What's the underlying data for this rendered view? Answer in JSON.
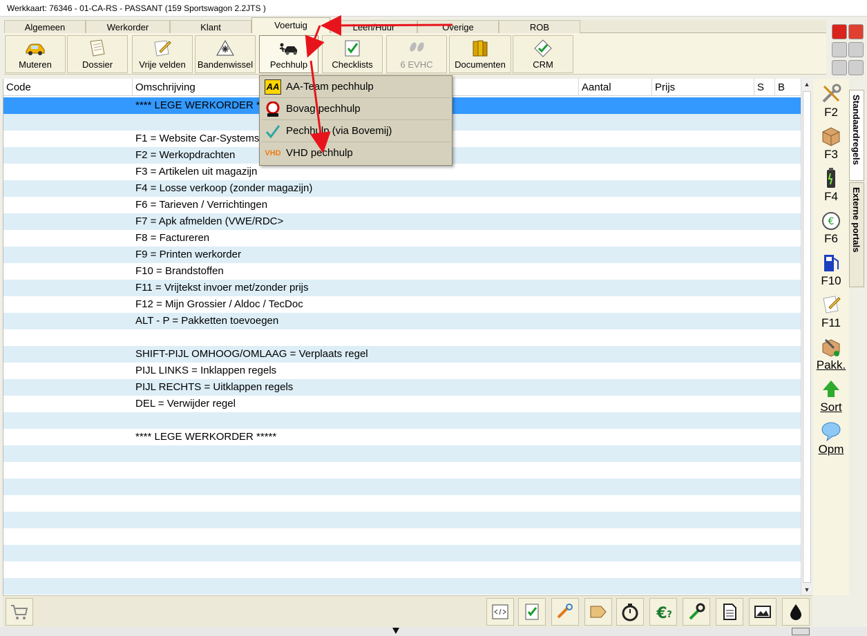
{
  "window": {
    "title": "Werkkaart: 76346 - 01-CA-RS - PASSANT  (159 Sportswagon  2.2JTS  )"
  },
  "tabs": [
    {
      "label": "Algemeen"
    },
    {
      "label": "Werkorder"
    },
    {
      "label": "Klant"
    },
    {
      "label": "Voertuig"
    },
    {
      "label": "Leen/Huur"
    },
    {
      "label": "Overige"
    },
    {
      "label": "ROB"
    }
  ],
  "toolbar": {
    "buttons": [
      {
        "label": "Muteren"
      },
      {
        "label": "Dossier"
      },
      {
        "label": "Vrije velden"
      },
      {
        "label": "Bandenwissel"
      },
      {
        "label": "Pechhulp"
      },
      {
        "label": "Checklists"
      },
      {
        "label": "6 EVHC"
      },
      {
        "label": "Documenten"
      },
      {
        "label": "CRM"
      }
    ]
  },
  "grid": {
    "headers": [
      "Code",
      "Omschrijving",
      "Aantal",
      "Prijs",
      "S",
      "B"
    ],
    "rows": [
      "**** LEGE WERKORDER *****",
      "",
      "F1 = Website Car-Systems",
      "F2 = Werkopdrachten",
      "F3 = Artikelen uit magazijn",
      "F4 = Losse verkoop (zonder magazijn)",
      "F6 = Tarieven / Verrichtingen",
      "F7 = Apk afmelden (VWE/RDC>",
      "F8 = Factureren",
      "F9 = Printen werkorder",
      "F10 = Brandstoffen",
      "F11 = Vrijtekst invoer met/zonder prijs",
      "F12 = Mijn Grossier / Aldoc / TecDoc",
      "ALT - P = Pakketten toevoegen",
      "",
      "SHIFT-PIJL OMHOOG/OMLAAG = Verplaats regel",
      "PIJL LINKS = Inklappen regels",
      "PIJL RECHTS = Uitklappen regels",
      "DEL = Verwijder regel",
      "",
      "**** LEGE WERKORDER *****",
      "",
      "",
      "",
      "",
      "",
      "",
      "",
      "",
      ""
    ]
  },
  "dropdown": {
    "items": [
      {
        "label": "AA-Team pechhulp",
        "icon": "aa-logo-icon",
        "icon_text": "AA"
      },
      {
        "label": "Bovag pechhulp",
        "icon": "bovag-logo-icon"
      },
      {
        "label": "Pechhulp (via Bovemij)",
        "icon": "checkmark-icon"
      },
      {
        "label": "VHD pechhulp",
        "icon": "vhd-logo-icon",
        "icon_text": "VHD"
      }
    ]
  },
  "sidebar": {
    "buttons": [
      {
        "label": "F2"
      },
      {
        "label": "F3"
      },
      {
        "label": "F4"
      },
      {
        "label": "F6"
      },
      {
        "label": "F10"
      },
      {
        "label": "F11"
      },
      {
        "label": "Pakk."
      },
      {
        "label": "Sort"
      },
      {
        "label": "Opm"
      }
    ],
    "vertical_tabs": [
      {
        "label": "Standaardregels"
      },
      {
        "label": "Externe portals"
      }
    ]
  },
  "colors": {
    "selected_row": "#3399ff",
    "alt_row": "#ddeef7",
    "annotation_arrow": "#e8141c"
  }
}
